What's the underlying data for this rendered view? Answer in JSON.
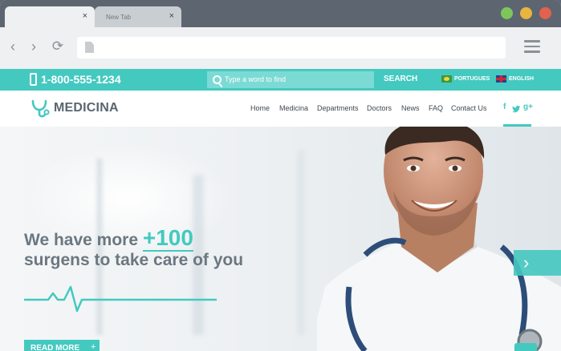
{
  "browser": {
    "tabs": [
      {
        "title": "",
        "close": "×"
      },
      {
        "title": "New Tab",
        "close": "×"
      }
    ],
    "address": ""
  },
  "topbar": {
    "phone": "1-800-555-1234",
    "search_placeholder": "Type a word to find",
    "search_label": "SEARCH",
    "languages": [
      "PORTUGUES",
      "ENGLISH"
    ]
  },
  "header": {
    "brand": "MEDICINA",
    "nav": [
      "Home",
      "Medicina",
      "Departments",
      "Doctors",
      "News",
      "FAQ",
      "Contact Us"
    ],
    "social": [
      "f",
      "t",
      "g+"
    ]
  },
  "hero": {
    "headline_prefix": "We have more ",
    "headline_accent": "+100",
    "headline_line2": "surgens to take care of you",
    "cta": "READ MORE",
    "cta_icon": "+",
    "next_icon": "›"
  },
  "colors": {
    "accent": "#44c9c0",
    "titlebar": "#5d6670",
    "text": "#6c7780"
  }
}
